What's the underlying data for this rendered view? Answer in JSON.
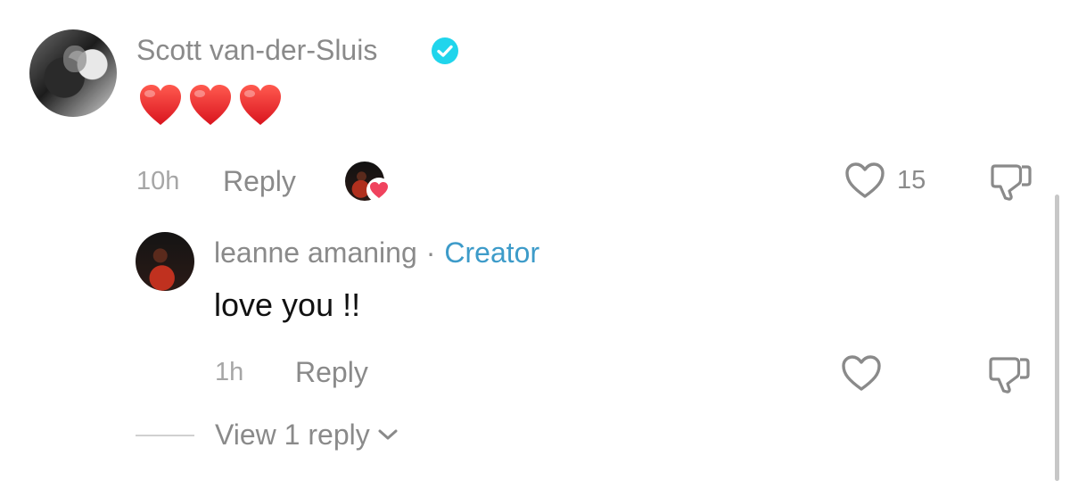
{
  "comment": {
    "author": "Scott van-der-Sluis",
    "verified_icon": "verified-badge-icon",
    "hearts_emoji": [
      "❤️",
      "❤️",
      "❤️"
    ],
    "time": "10h",
    "reply_label": "Reply",
    "like_count": "15",
    "like_icon": "heart-outline-icon",
    "dislike_icon": "thumbs-down-icon",
    "creator_liked_icon": "creator-liked-avatar",
    "accent_heart_color": "#f0435e",
    "verified_color": "#20d5ec"
  },
  "reply": {
    "author": "leanne amaning",
    "separator": "·",
    "badge": "Creator",
    "text": "love you !!",
    "time": "1h",
    "reply_label": "Reply",
    "like_icon": "heart-outline-icon",
    "dislike_icon": "thumbs-down-icon",
    "creator_color": "#3d9bc9"
  },
  "thread": {
    "view_replies_label": "View 1 reply",
    "chevron_icon": "chevron-down-icon"
  }
}
